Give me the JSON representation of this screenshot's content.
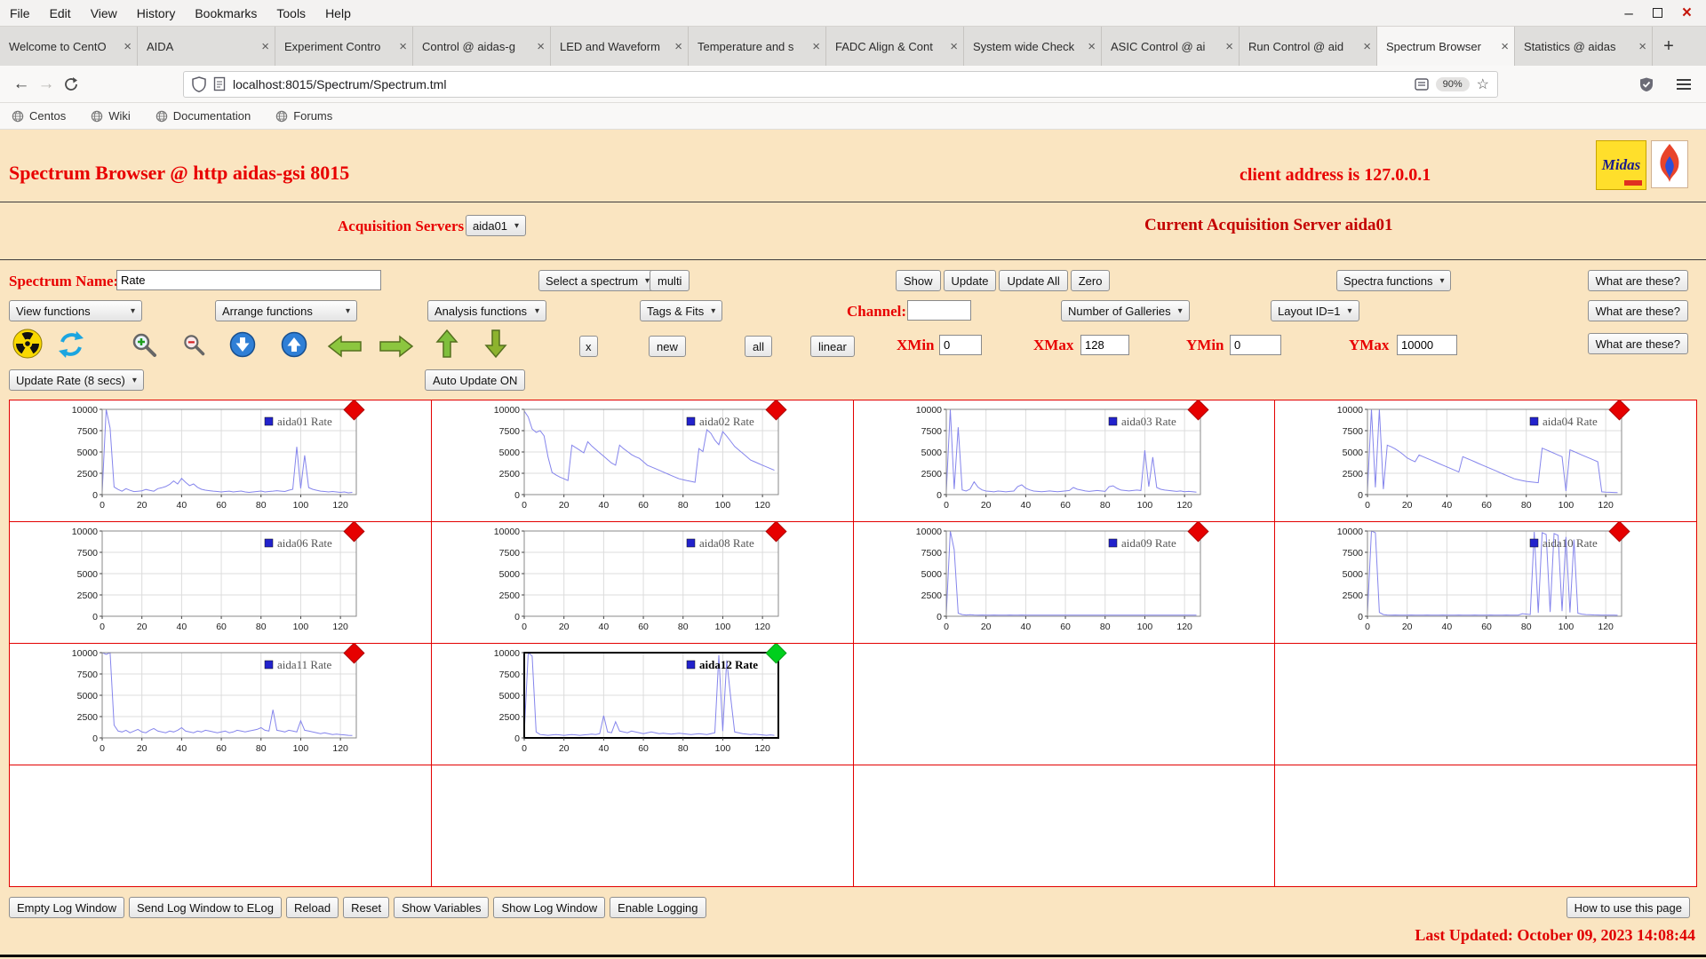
{
  "browser": {
    "menu": [
      "File",
      "Edit",
      "View",
      "History",
      "Bookmarks",
      "Tools",
      "Help"
    ],
    "window_controls": {
      "minimize": "–",
      "close": "×"
    },
    "tabs": [
      {
        "label": "Welcome to CentO",
        "active": false
      },
      {
        "label": "AIDA",
        "active": false
      },
      {
        "label": "Experiment Contro",
        "active": false
      },
      {
        "label": "Control @ aidas-g",
        "active": false
      },
      {
        "label": "LED and Waveform",
        "active": false
      },
      {
        "label": "Temperature and s",
        "active": false
      },
      {
        "label": "FADC Align & Cont",
        "active": false
      },
      {
        "label": "System wide Check",
        "active": false
      },
      {
        "label": "ASIC Control @ ai",
        "active": false
      },
      {
        "label": "Run Control @ aid",
        "active": false
      },
      {
        "label": "Spectrum Browser",
        "active": true
      },
      {
        "label": "Statistics @ aidas",
        "active": false
      }
    ],
    "tab_close": "×",
    "new_tab": "+",
    "nav": {
      "back": "←",
      "forward": "→"
    },
    "url": "localhost:8015/Spectrum/Spectrum.tml",
    "zoom_badge": "90%",
    "star": "☆",
    "bookmarks": [
      "Centos",
      "Wiki",
      "Documentation",
      "Forums"
    ]
  },
  "page": {
    "title": "Spectrum Browser @ http aidas-gsi 8015",
    "client_address": "client address is 127.0.0.1",
    "logo_text": "Midas",
    "acquisition": {
      "label": "Acquisition Servers",
      "selected": "aida01",
      "current": "Current Acquisition Server aida01"
    },
    "controls": {
      "spectrum_name_label": "Spectrum Name:",
      "spectrum_name_value": "Rate",
      "select_spectrum": "Select a spectrum",
      "multi": "multi",
      "show": "Show",
      "update": "Update",
      "update_all": "Update All",
      "zero": "Zero",
      "spectra_functions": "Spectra functions",
      "what_are_these": "What are these?",
      "view_functions": "View functions",
      "arrange_functions": "Arrange functions",
      "analysis_functions": "Analysis functions",
      "tags_fits": "Tags & Fits",
      "channel_label": "Channel:",
      "channel_value": "",
      "number_of_galleries": "Number of Galleries",
      "layout_id": "Layout ID=1",
      "x": "x",
      "new": "new",
      "all": "all",
      "linear": "linear",
      "xmin_label": "XMin",
      "xmin_value": "0",
      "xmax_label": "XMax",
      "xmax_value": "128",
      "ymin_label": "YMin",
      "ymin_value": "0",
      "ymax_label": "YMax",
      "ymax_value": "10000",
      "update_rate": "Update Rate (8 secs)",
      "auto_update": "Auto Update ON"
    },
    "toolbar_icons": [
      "radiation",
      "refresh",
      "zoom-in",
      "zoom-out",
      "circle-down",
      "circle-up",
      "arrow-left",
      "arrow-right",
      "arrow-up",
      "arrow-down"
    ],
    "gallery": {
      "rows": 4,
      "cols": 4
    },
    "footer": {
      "buttons": [
        "Empty Log Window",
        "Send Log Window to ELog",
        "Reload",
        "Reset",
        "Show Variables",
        "Show Log Window",
        "Enable Logging"
      ],
      "how_to": "How to use this page",
      "last_updated": "Last Updated: October 09, 2023 14:08:44"
    },
    "colors": {
      "page_bg": "#fae5c1",
      "accent_red": "#e80000",
      "grid_border": "#e30000",
      "diamond_red": "#e60000",
      "diamond_green": "#00cf1d"
    }
  },
  "chart_data": {
    "type": "line",
    "title": "",
    "xlabel": "",
    "ylabel": "",
    "xlim": [
      0,
      128
    ],
    "ylim": [
      0,
      10000
    ],
    "x_ticks": [
      0,
      20,
      40,
      60,
      80,
      100,
      120
    ],
    "y_ticks": [
      0,
      2500,
      5000,
      7500,
      10000
    ],
    "grid": true,
    "legend_position": "top-right",
    "line_color": "#8585ec",
    "legend_color": "#2222cc",
    "charts": [
      {
        "id": "aida01",
        "legend": "aida01 Rate",
        "row": 0,
        "col": 0,
        "marker_color": "#e60000",
        "selected": false,
        "values": [
          300,
          10000,
          7800,
          900,
          600,
          400,
          700,
          500,
          350,
          400,
          450,
          600,
          500,
          400,
          700,
          800,
          950,
          1200,
          1600,
          1250,
          1900,
          1450,
          1050,
          1250,
          850,
          620,
          520,
          460,
          410,
          360,
          310,
          360,
          410,
          310,
          360,
          420,
          310,
          260,
          310,
          360,
          420,
          310,
          360,
          410,
          460,
          410,
          360,
          510,
          620,
          5600,
          720,
          4600,
          820,
          620,
          510,
          410,
          360,
          310,
          360,
          310,
          260,
          310,
          210,
          260
        ]
      },
      {
        "id": "aida02",
        "legend": "aida02 Rate",
        "row": 0,
        "col": 1,
        "marker_color": "#e60000",
        "selected": false,
        "values": [
          9800,
          9100,
          7700,
          7300,
          7500,
          6900,
          4400,
          2600,
          2300,
          2050,
          1850,
          1650,
          5800,
          5500,
          5200,
          4900,
          6200,
          5700,
          5300,
          4900,
          4500,
          4100,
          3700,
          3450,
          5800,
          5400,
          5050,
          4700,
          4450,
          4250,
          3850,
          3450,
          3250,
          3050,
          2850,
          2650,
          2450,
          2250,
          2050,
          1850,
          1750,
          1650,
          1550,
          1450,
          5400,
          5050,
          7600,
          7200,
          6400,
          5850,
          7400,
          6850,
          6250,
          5650,
          5250,
          4850,
          4450,
          4050,
          3850,
          3650,
          3450,
          3250,
          3050,
          2850
        ]
      },
      {
        "id": "aida03",
        "legend": "aida03 Rate",
        "row": 0,
        "col": 2,
        "marker_color": "#e60000",
        "selected": false,
        "values": [
          350,
          10000,
          650,
          7900,
          550,
          420,
          650,
          1500,
          850,
          550,
          420,
          370,
          320,
          420,
          370,
          320,
          370,
          420,
          950,
          1150,
          750,
          550,
          420,
          370,
          330,
          380,
          430,
          380,
          330,
          380,
          430,
          480,
          830,
          630,
          530,
          430,
          380,
          430,
          480,
          430,
          380,
          930,
          1030,
          730,
          530,
          480,
          430,
          480,
          530,
          480,
          5200,
          930,
          4400,
          830,
          630,
          530,
          480,
          430,
          380,
          430,
          330,
          380,
          330,
          280
        ]
      },
      {
        "id": "aida04",
        "legend": "aida04 Rate",
        "row": 0,
        "col": 3,
        "marker_color": "#e60000",
        "selected": false,
        "values": [
          450,
          10000,
          850,
          10000,
          650,
          5800,
          5600,
          5350,
          5050,
          4700,
          4300,
          4050,
          3850,
          4650,
          4450,
          4250,
          4050,
          3850,
          3650,
          3450,
          3250,
          3050,
          2850,
          2650,
          4450,
          4250,
          4050,
          3850,
          3650,
          3450,
          3250,
          3050,
          2850,
          2650,
          2450,
          2250,
          2050,
          1850,
          1750,
          1650,
          1550,
          1500,
          1450,
          1400,
          5450,
          5250,
          5050,
          4850,
          4650,
          4450,
          420,
          5250,
          5050,
          4850,
          4650,
          4450,
          4250,
          4050,
          3850,
          320,
          290,
          270,
          250,
          230
        ]
      },
      {
        "id": "aida06",
        "legend": "aida06 Rate",
        "row": 1,
        "col": 0,
        "marker_color": "#e60000",
        "selected": false,
        "values": [
          0,
          0,
          0,
          0,
          0,
          0,
          0,
          0,
          0,
          0,
          0,
          0,
          0,
          0,
          0,
          0,
          0,
          0,
          0,
          0,
          0,
          0,
          0,
          0,
          0,
          0,
          0,
          0,
          0,
          0,
          0,
          0,
          0,
          0,
          0,
          0,
          0,
          0,
          0,
          0,
          0,
          0,
          0,
          0,
          0,
          0,
          0,
          0,
          0,
          0,
          0,
          0,
          0,
          0,
          0,
          0,
          0,
          0,
          0,
          0,
          0,
          0,
          0,
          0
        ]
      },
      {
        "id": "aida08",
        "legend": "aida08 Rate",
        "row": 1,
        "col": 1,
        "marker_color": "#e60000",
        "selected": false,
        "values": [
          0,
          0,
          0,
          0,
          0,
          0,
          0,
          0,
          0,
          0,
          0,
          0,
          0,
          0,
          0,
          0,
          0,
          0,
          0,
          0,
          0,
          0,
          0,
          0,
          0,
          0,
          0,
          0,
          0,
          0,
          0,
          0,
          0,
          0,
          0,
          0,
          0,
          0,
          0,
          0,
          0,
          0,
          0,
          0,
          0,
          0,
          0,
          0,
          0,
          0,
          0,
          0,
          0,
          0,
          0,
          0,
          0,
          0,
          0,
          0,
          0,
          0,
          0,
          0
        ]
      },
      {
        "id": "aida09",
        "legend": "aida09 Rate",
        "row": 1,
        "col": 2,
        "marker_color": "#e60000",
        "selected": false,
        "values": [
          250,
          10000,
          7800,
          350,
          200,
          150,
          180,
          150,
          130,
          150,
          140,
          130,
          150,
          140,
          130,
          140,
          150,
          130,
          140,
          150,
          130,
          140,
          130,
          140,
          130,
          140,
          130,
          140,
          130,
          140,
          130,
          140,
          130,
          140,
          130,
          140,
          130,
          140,
          130,
          140,
          130,
          140,
          130,
          140,
          130,
          140,
          130,
          140,
          130,
          140,
          130,
          140,
          130,
          140,
          130,
          140,
          130,
          140,
          130,
          140,
          130,
          140,
          130,
          120
        ]
      },
      {
        "id": "aida10",
        "legend": "aida10 Rate",
        "row": 1,
        "col": 3,
        "marker_color": "#e60000",
        "selected": false,
        "values": [
          350,
          10000,
          9800,
          450,
          200,
          150,
          140,
          150,
          140,
          130,
          140,
          150,
          140,
          130,
          140,
          150,
          140,
          130,
          140,
          150,
          140,
          130,
          140,
          150,
          140,
          130,
          140,
          150,
          140,
          130,
          140,
          150,
          140,
          130,
          140,
          150,
          140,
          130,
          140,
          300,
          250,
          200,
          9900,
          400,
          9800,
          9600,
          500,
          9700,
          9500,
          600,
          9300,
          450,
          9000,
          350,
          250,
          200,
          180,
          160,
          150,
          140,
          130,
          120,
          120,
          110
        ]
      },
      {
        "id": "aida11",
        "legend": "aida11 Rate",
        "row": 2,
        "col": 0,
        "marker_color": "#e60000",
        "selected": false,
        "values": [
          10000,
          9800,
          10000,
          1500,
          800,
          700,
          900,
          600,
          800,
          1000,
          700,
          600,
          900,
          1100,
          800,
          700,
          600,
          800,
          700,
          900,
          1200,
          800,
          700,
          600,
          800,
          700,
          900,
          800,
          700,
          600,
          700,
          800,
          600,
          700,
          900,
          800,
          700,
          800,
          900,
          1000,
          1200,
          900,
          800,
          3300,
          900,
          800,
          700,
          900,
          800,
          700,
          2000,
          900,
          800,
          700,
          600,
          500,
          600,
          500,
          400,
          450,
          400,
          350,
          300,
          280
        ]
      },
      {
        "id": "aida12",
        "legend": "aida12 Rate",
        "row": 2,
        "col": 1,
        "marker_color": "#00cf1d",
        "selected": true,
        "values": [
          550,
          10000,
          9600,
          700,
          400,
          350,
          300,
          350,
          400,
          350,
          300,
          350,
          400,
          350,
          300,
          350,
          400,
          450,
          400,
          500,
          2600,
          700,
          600,
          1900,
          800,
          700,
          600,
          800,
          700,
          600,
          500,
          600,
          700,
          600,
          500,
          550,
          500,
          450,
          500,
          550,
          500,
          450,
          400,
          450,
          500,
          450,
          400,
          500,
          600,
          9700,
          800,
          9100,
          4700,
          700,
          600,
          500,
          450,
          400,
          450,
          400,
          350,
          300,
          350,
          300
        ]
      }
    ]
  }
}
